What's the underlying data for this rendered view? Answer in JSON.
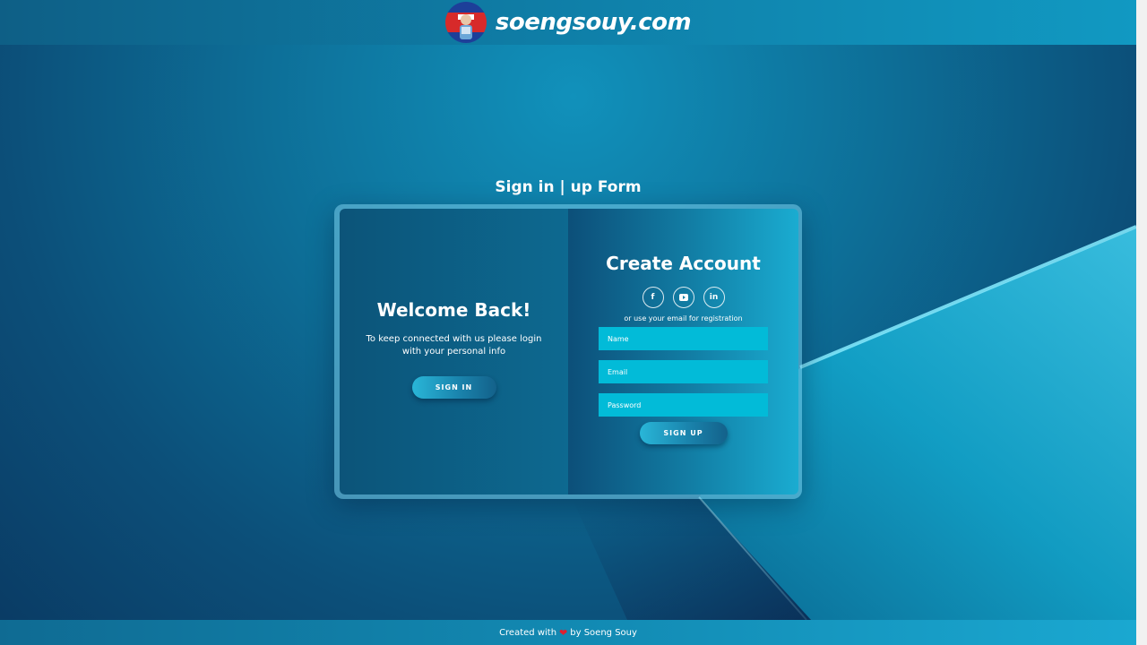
{
  "header": {
    "brand": "soengsouy.com"
  },
  "page": {
    "title": "Sign in | up Form"
  },
  "welcome_panel": {
    "heading": "Welcome Back!",
    "text": "To keep connected with us please login with your personal info",
    "button_label": "SIGN IN"
  },
  "signup_panel": {
    "heading": "Create Account",
    "socials": [
      {
        "icon": "facebook-icon",
        "glyph": "f"
      },
      {
        "icon": "youtube-icon",
        "glyph": "▶"
      },
      {
        "icon": "linkedin-icon",
        "glyph": "in"
      }
    ],
    "alt_text": "or use your email for registration",
    "fields": {
      "name_placeholder": "Name",
      "email_placeholder": "Email",
      "password_placeholder": "Password"
    },
    "button_label": "SIGN UP"
  },
  "footer": {
    "prefix": "Created with",
    "heart": "❤",
    "suffix": "by Soeng Souy"
  },
  "colors": {
    "background": "#0d6f98",
    "input": "#02bbd8",
    "heart": "#e01f2e"
  }
}
